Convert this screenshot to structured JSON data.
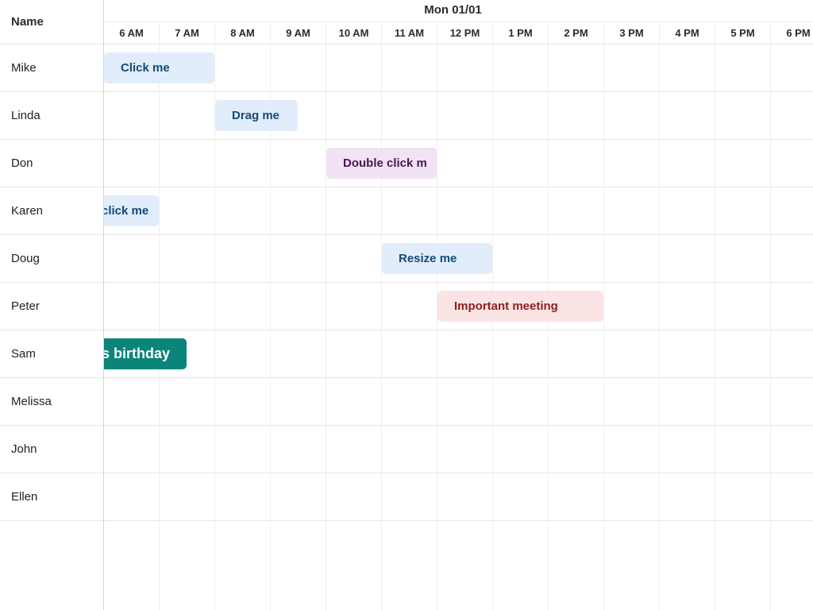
{
  "header": {
    "name_label": "Name",
    "date_label": "Mon 01/01"
  },
  "hours": [
    "6 AM",
    "7 AM",
    "8 AM",
    "9 AM",
    "10 AM",
    "11 AM",
    "12 PM",
    "1 PM",
    "2 PM",
    "3 PM",
    "4 PM",
    "5 PM",
    "6 PM"
  ],
  "resources": [
    "Mike",
    "Linda",
    "Don",
    "Karen",
    "Doug",
    "Peter",
    "Sam",
    "Melissa",
    "John",
    "Ellen"
  ],
  "events": {
    "mike": "Click me",
    "linda": "Drag me",
    "don": "Double click m",
    "karen": "click me",
    "doug": "Resize me",
    "peter": "Important meeting",
    "sam": "s birthday"
  },
  "colors": {
    "event_blue_bg": "#e1edfb",
    "event_blue_text": "#134a77",
    "event_purple_bg": "#f1e2f4",
    "event_red_bg": "#fbe4e4",
    "event_teal_bg": "#0b8479"
  }
}
